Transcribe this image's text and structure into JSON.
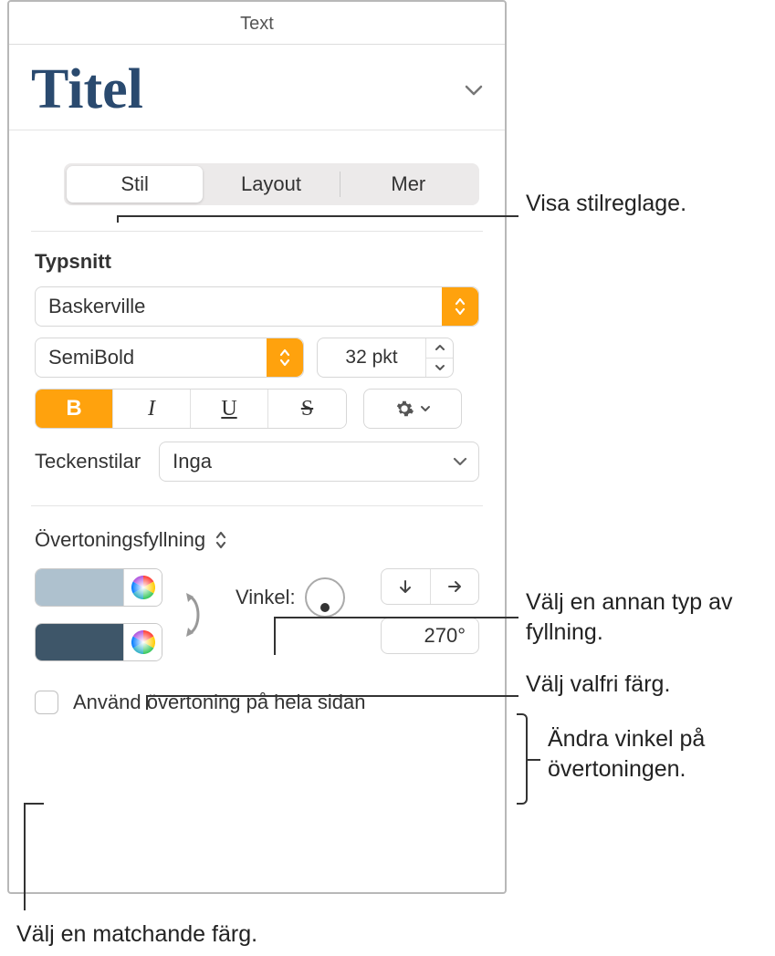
{
  "header": {
    "title": "Text"
  },
  "titleStyle": {
    "name": "Titel"
  },
  "tabs": {
    "style": "Stil",
    "layout": "Layout",
    "more": "Mer"
  },
  "font": {
    "sectionLabel": "Typsnitt",
    "family": "Baskerville",
    "weight": "SemiBold",
    "size": "32 pkt",
    "bold": "B",
    "italic": "I",
    "underline": "U",
    "strike": "S",
    "charStylesLabel": "Teckenstilar",
    "charStylesValue": "Inga"
  },
  "fill": {
    "typeLabel": "Övertoningsfyllning",
    "swatch1": "#aec1ce",
    "swatch2": "#3e5669",
    "angleLabel": "Vinkel:",
    "angleValue": "270°",
    "applyPageLabel": "Använd övertoning på hela sidan"
  },
  "callouts": {
    "styleControls": "Visa stilreglage.",
    "fillType": "Välj en annan typ av fyllning.",
    "anyColor": "Välj valfri färg.",
    "gradientAngle": "Ändra vinkel på övertoningen.",
    "matchingColor": "Välj en matchande färg."
  }
}
